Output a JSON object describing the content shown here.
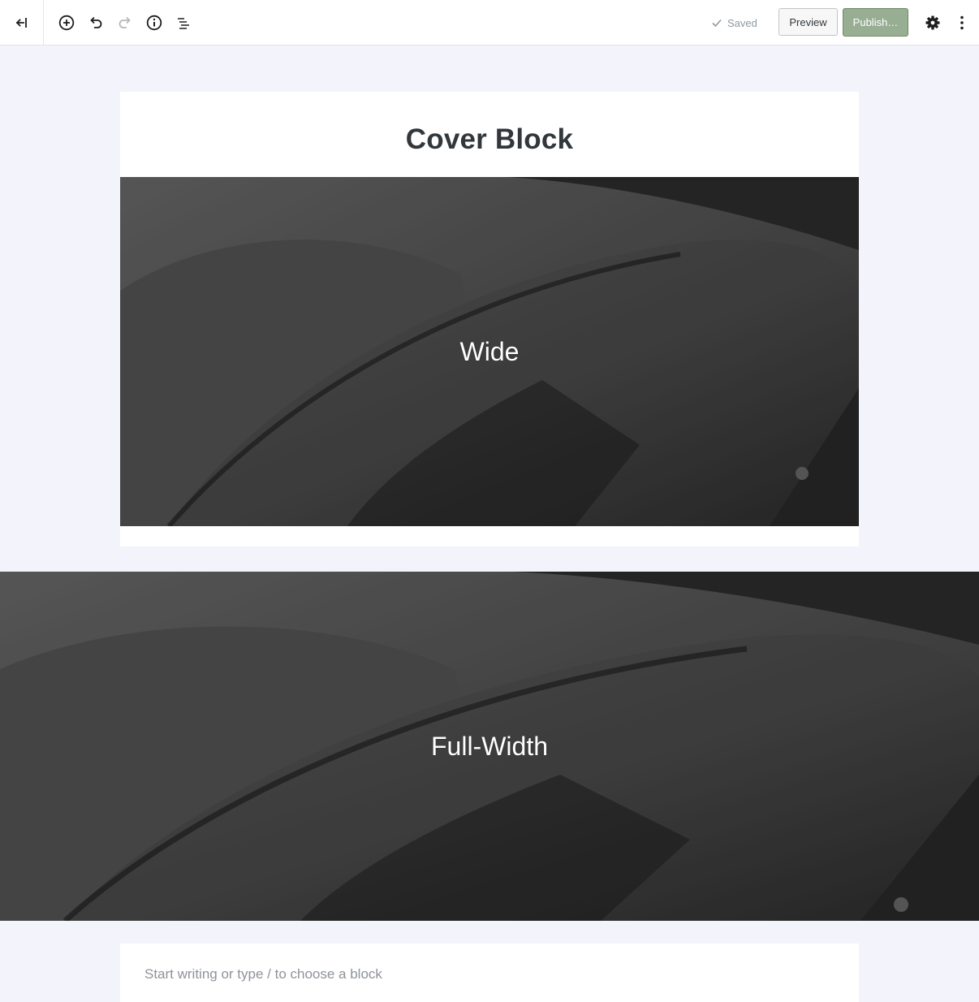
{
  "toolbar": {
    "icons": {
      "back": "arrow-left-bar-icon",
      "add": "plus-circle-icon",
      "undo": "undo-icon",
      "redo": "redo-icon",
      "info": "info-icon",
      "outline": "list-outline-icon",
      "settings": "gear-icon",
      "more": "more-vertical-icon"
    },
    "saved_label": "Saved",
    "preview_label": "Preview",
    "publish_label": "Publish…"
  },
  "post": {
    "title": "Cover Block"
  },
  "blocks": {
    "cover_wide": {
      "text": "Wide"
    },
    "cover_full": {
      "text": "Full-Width"
    },
    "appender_placeholder": "Start writing or type / to choose a block"
  },
  "colors": {
    "publish_bg": "#97ae93",
    "canvas_bg": "#f3f4fb",
    "text": "#32373c"
  }
}
